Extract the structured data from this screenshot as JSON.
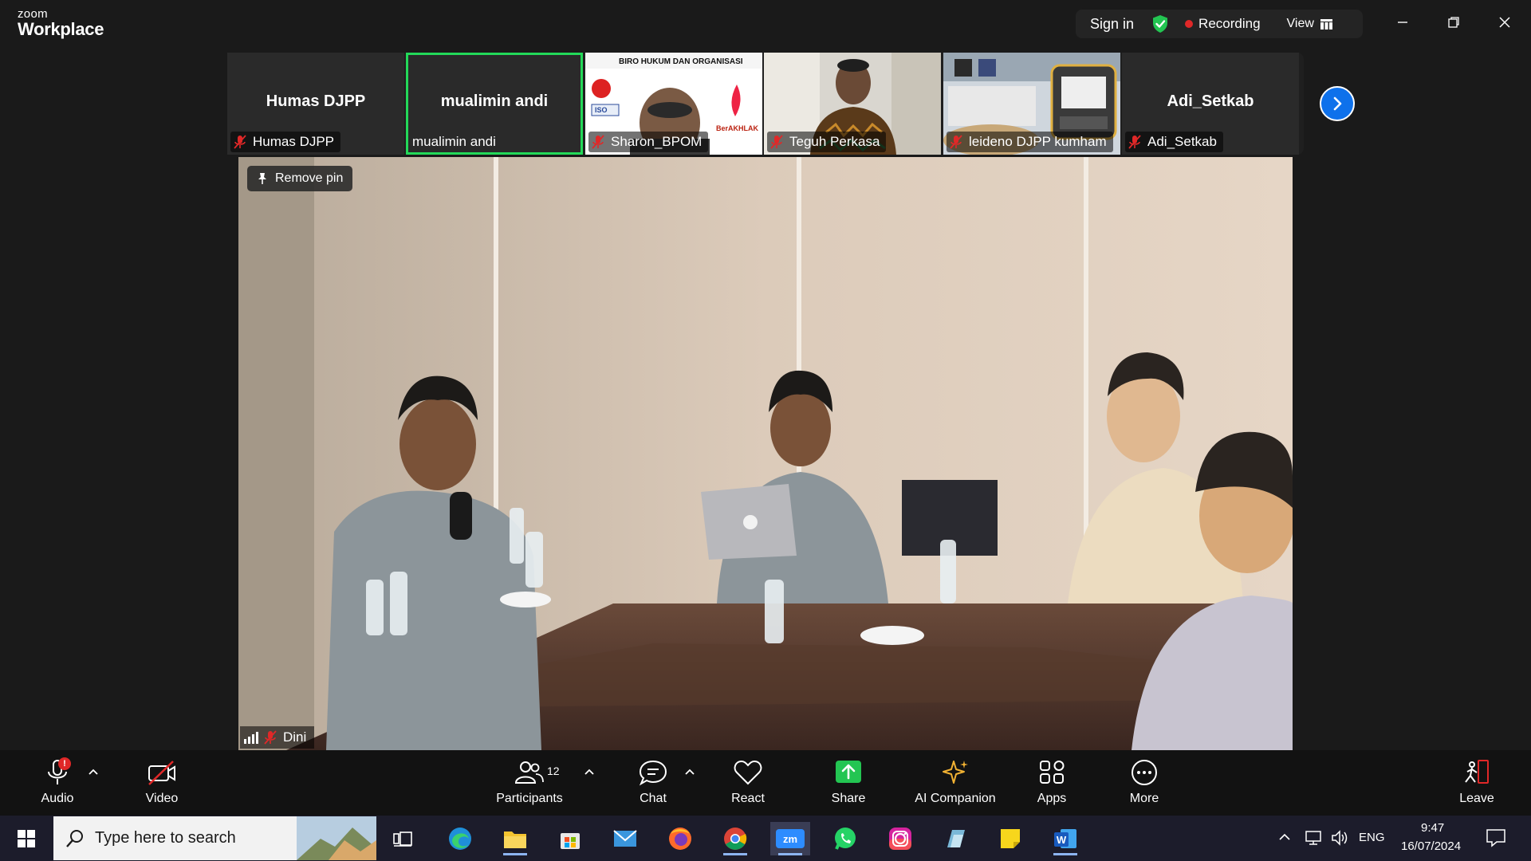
{
  "app": {
    "logo_small": "zoom",
    "logo_big": "Workplace"
  },
  "topbar": {
    "sign_in": "Sign in",
    "recording": "Recording",
    "view": "View"
  },
  "colors": {
    "active_speaker": "#23d959",
    "accent": "#0e71eb",
    "record": "#e02828",
    "toolbar_bg": "#121212"
  },
  "thumbnails": [
    {
      "big_name": "Humas DJPP",
      "label": "Humas DJPP",
      "muted": true,
      "video": false,
      "active": false
    },
    {
      "big_name": "mualimin andi",
      "label": "mualimin andi",
      "muted": false,
      "video": false,
      "active": true
    },
    {
      "big_name": "",
      "label": "Sharon_BPOM",
      "muted": true,
      "video": true,
      "active": false,
      "overlay_text": "BIRO HUKUM DAN ORGANISASI",
      "overlay_text2": "BerAKHLAK",
      "overlay_text3": "ISO"
    },
    {
      "big_name": "",
      "label": "Teguh Perkasa",
      "muted": true,
      "video": true,
      "active": false
    },
    {
      "big_name": "",
      "label": "leideno DJPP kumham",
      "muted": true,
      "video": true,
      "active": false
    },
    {
      "big_name": "Adi_Setkab",
      "label": "Adi_Setkab",
      "muted": true,
      "video": false,
      "active": false
    }
  ],
  "main_video": {
    "pin_button": "Remove pin",
    "speaker": "Dini"
  },
  "toolbar": {
    "audio": "Audio",
    "audio_badge": "!",
    "video": "Video",
    "participants": "Participants",
    "participants_count": "12",
    "chat": "Chat",
    "react": "React",
    "share": "Share",
    "ai_companion": "AI Companion",
    "apps": "Apps",
    "more": "More",
    "leave": "Leave"
  },
  "taskbar": {
    "search_placeholder": "Type here to search",
    "language": "ENG",
    "time": "9:47",
    "date": "16/07/2024"
  }
}
